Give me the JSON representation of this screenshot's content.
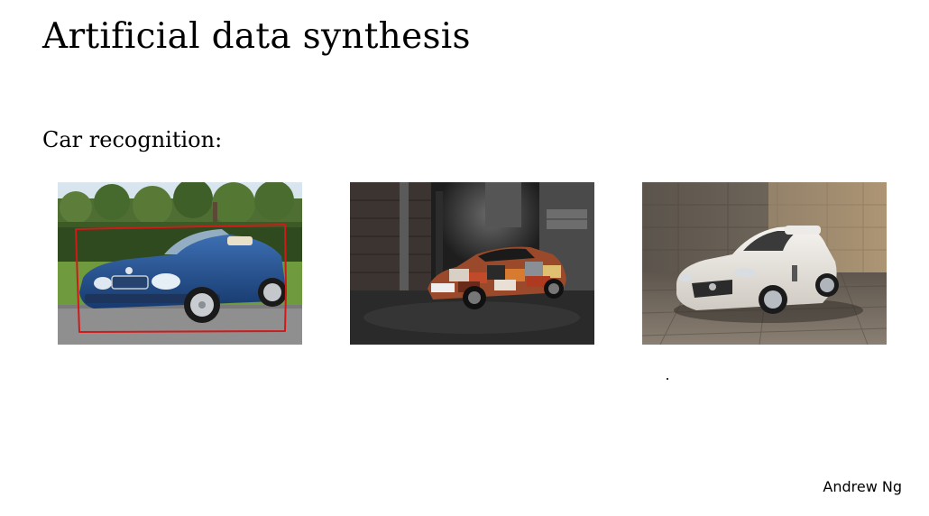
{
  "slide": {
    "title": "Artificial data synthesis",
    "subtitle": "Car recognition:",
    "author": "Andrew Ng"
  },
  "images": [
    {
      "name": "blue-convertible-photo",
      "annotation_color": "#d01a1a"
    },
    {
      "name": "camouflage-car-photo"
    },
    {
      "name": "white-sports-car-photo"
    }
  ]
}
